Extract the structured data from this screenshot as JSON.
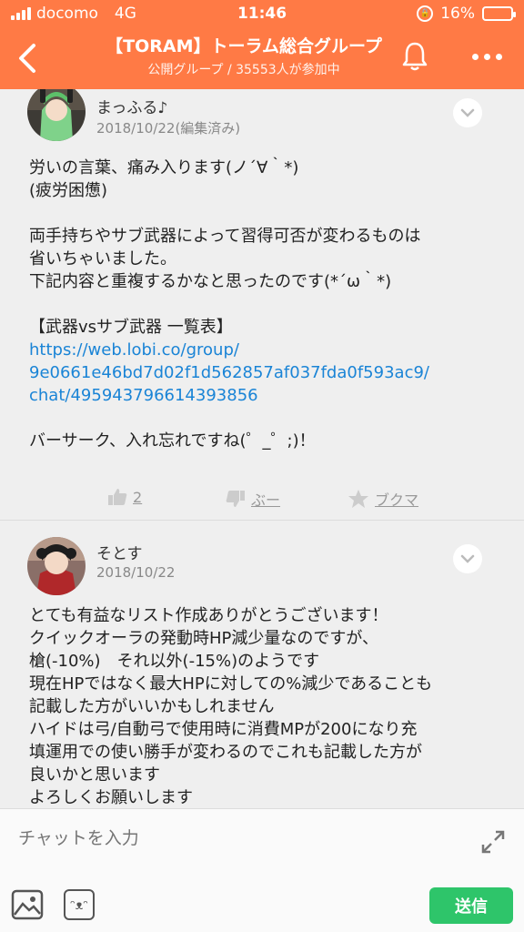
{
  "status_bar": {
    "carrier": "docomo",
    "network": "4G",
    "time": "11:46",
    "battery_percent": "16%",
    "battery_level": 0.16
  },
  "nav": {
    "title": "【TORAM】トーラム総合グループ",
    "subtitle": "公開グループ / 35553人が参加中"
  },
  "posts": [
    {
      "author": "まっふる♪",
      "date": "2018/10/22(編集済み)",
      "lines": [
        "労いの言葉、痛み入ります(ノ´∀｀*)",
        "(疲労困憊)",
        "",
        "両手持ちやサブ武器によって習得可否が変わるものは",
        "省いちゃいました。",
        "下記内容と重複するかなと思ったのです(*´ω｀*)",
        "",
        "【武器vsサブ武器 一覧表】"
      ],
      "link_lines": [
        "https://web.lobi.co/group/",
        "9e0661e46bd7d02f1d562857af037fda0f593ac9/",
        "chat/495943796614393856"
      ],
      "after_lines": [
        "",
        "バーサーク、入れ忘れですね(゜_゜;)！"
      ],
      "actions": {
        "like_count": "2",
        "boo_label": "ぶー",
        "bookmark_label": "ブクマ"
      }
    },
    {
      "author": "そとす",
      "date": "2018/10/22",
      "lines": [
        "とても有益なリスト作成ありがとうございます！",
        "クイックオーラの発動時HP減少量なのですが、",
        "槍(-10%)　それ以外(-15%)のようです",
        "現在HPではなく最大HPに対しての%減少であることも",
        "記載した方がいいかもしれません",
        "ハイドは弓/自動弓で使用時に消費MPが200になり充",
        "填運用での使い勝手が変わるのでこれも記載した方が",
        "良いかと思います",
        "よろしくお願いします"
      ]
    }
  ],
  "input": {
    "placeholder": "チャットを入力",
    "send_label": "送信"
  },
  "colors": {
    "header": "#ff7a45",
    "link": "#1a84d6",
    "send": "#2ec56a"
  }
}
